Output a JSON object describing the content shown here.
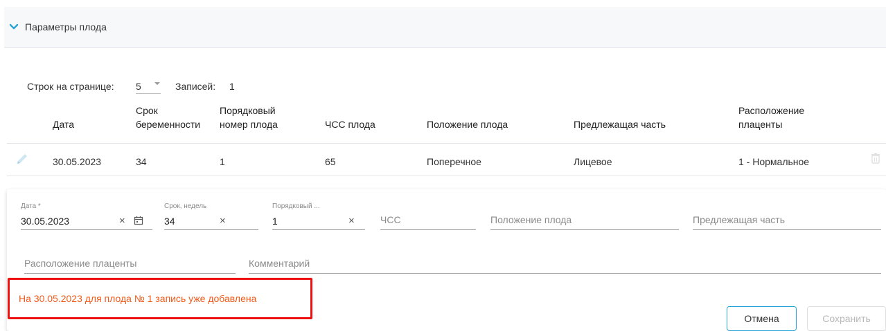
{
  "section": {
    "title": "Параметры плода"
  },
  "pager": {
    "rows_label": "Строк на странице:",
    "rows_value": "5",
    "records_label": "Записей:",
    "records_value": "1"
  },
  "table": {
    "headers": {
      "date": "Дата",
      "term_l1": "Срок",
      "term_l2": "беременности",
      "num_l1": "Порядковый",
      "num_l2": "номер плода",
      "hr": "ЧСС плода",
      "pos": "Положение плода",
      "pres": "Предлежащая часть",
      "plac_l1": "Расположение",
      "plac_l2": "плаценты"
    },
    "rows": [
      {
        "date": "30.05.2023",
        "term": "34",
        "num": "1",
        "hr": "65",
        "pos": "Поперечное",
        "pres": "Лицевое",
        "plac": "1 - Нормальное"
      }
    ]
  },
  "form": {
    "date_label": "Дата *",
    "date_value": "30.05.2023",
    "term_label": "Срок, недель",
    "term_value": "34",
    "num_label": "Порядковый ...",
    "num_value": "1",
    "hr_placeholder": "ЧСС",
    "pos_placeholder": "Положение плода",
    "pres_placeholder": "Предлежащая часть",
    "plac_placeholder": "Расположение плаценты",
    "comment_placeholder": "Комментарий",
    "clear_symbol": "×"
  },
  "error": {
    "message": "На 30.05.2023 для плода № 1 запись уже добавлена"
  },
  "buttons": {
    "cancel": "Отмена",
    "save": "Сохранить"
  },
  "colors": {
    "accent": "#2aa3d6",
    "error": "#f05a1a",
    "highlight": "#ee1111"
  }
}
